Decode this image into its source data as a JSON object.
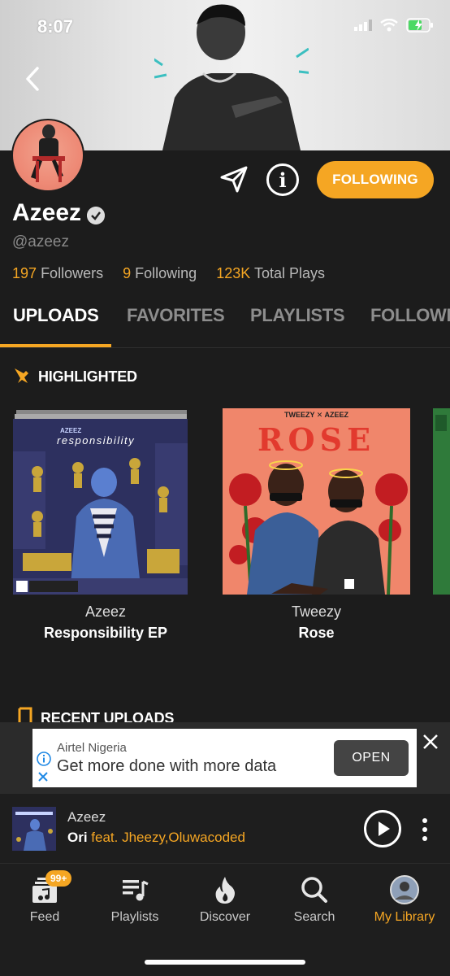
{
  "status_bar": {
    "time": "8:07"
  },
  "profile": {
    "name": "Azeez",
    "handle": "@azeez",
    "follow_button": "FOLLOWING",
    "stats": {
      "followers_count": "197",
      "followers_label": "Followers",
      "following_count": "9",
      "following_label": "Following",
      "plays_count": "123K",
      "plays_label": "Total Plays"
    }
  },
  "tabs": [
    "UPLOADS",
    "FAVORITES",
    "PLAYLISTS",
    "FOLLOWI"
  ],
  "sections": {
    "highlighted": "HIGHLIGHTED",
    "recent_uploads": "RECENT UPLOADS"
  },
  "highlighted_items": [
    {
      "artist": "Azeez",
      "title": "Responsibility EP",
      "cover_text": "responsibility"
    },
    {
      "artist": "Tweezy",
      "title": "Rose",
      "cover_text": "ROSE",
      "cover_header": "TWEEZY ✕ AZEEZ"
    }
  ],
  "ad": {
    "advertiser": "Airtel Nigeria",
    "text": "Get more done with more data",
    "cta": "OPEN"
  },
  "now_playing": {
    "artist": "Azeez",
    "track": "Ori",
    "featuring": "feat. Jheezy,Oluwacoded"
  },
  "tab_bar": {
    "badge": "99+",
    "items": [
      {
        "label": "Feed",
        "icon": "feed-icon"
      },
      {
        "label": "Playlists",
        "icon": "playlists-icon"
      },
      {
        "label": "Discover",
        "icon": "fire-icon"
      },
      {
        "label": "Search",
        "icon": "search-icon"
      },
      {
        "label": "My Library",
        "icon": "avatar-icon"
      }
    ]
  },
  "colors": {
    "accent": "#f5a623",
    "background": "#1c1c1c"
  }
}
